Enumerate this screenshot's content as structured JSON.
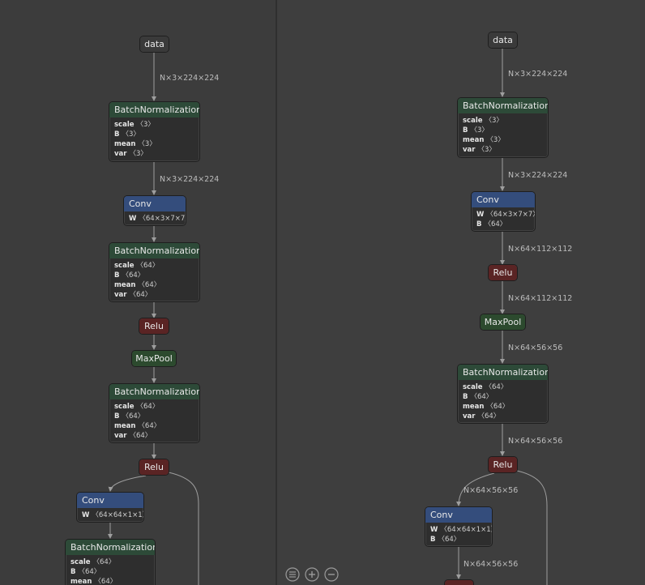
{
  "left": {
    "nodes": [
      {
        "title": "data",
        "type": "io"
      },
      {
        "title": "BatchNormalization",
        "type": "bn",
        "attrs": [
          [
            "scale",
            "〈3〉"
          ],
          [
            "B",
            "〈3〉"
          ],
          [
            "mean",
            "〈3〉"
          ],
          [
            "var",
            "〈3〉"
          ]
        ]
      },
      {
        "title": "Conv",
        "type": "conv",
        "attrs": [
          [
            "W",
            "〈64×3×7×7〉"
          ]
        ]
      },
      {
        "title": "BatchNormalization",
        "type": "bn",
        "attrs": [
          [
            "scale",
            "〈64〉"
          ],
          [
            "B",
            "〈64〉"
          ],
          [
            "mean",
            "〈64〉"
          ],
          [
            "var",
            "〈64〉"
          ]
        ]
      },
      {
        "title": "Relu",
        "type": "relu"
      },
      {
        "title": "MaxPool",
        "type": "pool"
      },
      {
        "title": "BatchNormalization",
        "type": "bn",
        "attrs": [
          [
            "scale",
            "〈64〉"
          ],
          [
            "B",
            "〈64〉"
          ],
          [
            "mean",
            "〈64〉"
          ],
          [
            "var",
            "〈64〉"
          ]
        ]
      },
      {
        "title": "Relu",
        "type": "relu"
      },
      {
        "title": "Conv",
        "type": "conv",
        "attrs": [
          [
            "W",
            "〈64×64×1×1〉"
          ]
        ]
      },
      {
        "title": "BatchNormalization",
        "type": "bn",
        "attrs": [
          [
            "scale",
            "〈64〉"
          ],
          [
            "B",
            "〈64〉"
          ],
          [
            "mean",
            "〈64〉"
          ]
        ]
      }
    ],
    "edge_labels": [
      "N×3×224×224",
      "N×3×224×224"
    ]
  },
  "right": {
    "nodes": [
      {
        "title": "data",
        "type": "io"
      },
      {
        "title": "BatchNormalization",
        "type": "bn",
        "attrs": [
          [
            "scale",
            "〈3〉"
          ],
          [
            "B",
            "〈3〉"
          ],
          [
            "mean",
            "〈3〉"
          ],
          [
            "var",
            "〈3〉"
          ]
        ]
      },
      {
        "title": "Conv",
        "type": "conv",
        "attrs": [
          [
            "W",
            "〈64×3×7×7〉"
          ],
          [
            "B",
            "〈64〉"
          ]
        ]
      },
      {
        "title": "Relu",
        "type": "relu"
      },
      {
        "title": "MaxPool",
        "type": "pool"
      },
      {
        "title": "BatchNormalization",
        "type": "bn",
        "attrs": [
          [
            "scale",
            "〈64〉"
          ],
          [
            "B",
            "〈64〉"
          ],
          [
            "mean",
            "〈64〉"
          ],
          [
            "var",
            "〈64〉"
          ]
        ]
      },
      {
        "title": "Relu",
        "type": "relu"
      },
      {
        "title": "Conv",
        "type": "conv",
        "attrs": [
          [
            "W",
            "〈64×64×1×1〉"
          ],
          [
            "B",
            "〈64〉"
          ]
        ]
      },
      {
        "title": "",
        "type": "relu"
      }
    ],
    "edge_labels": [
      "N×3×224×224",
      "N×3×224×224",
      "N×64×112×112",
      "N×64×112×112",
      "N×64×56×56",
      "N×64×56×56",
      "N×64×56×56",
      "N×64×56×56"
    ]
  },
  "toolbar": {
    "icons": [
      "list-icon",
      "zoom-in-icon",
      "zoom-out-icon"
    ],
    "color": "#9a9a9a"
  },
  "colors": {
    "background": "#3c3c3c",
    "batchnorm_header": "#2d4a38",
    "conv_header": "#344d7c",
    "relu_header": "#5a2424",
    "maxpool_header": "#2c4a2e",
    "edge": "#9e9e9e"
  }
}
